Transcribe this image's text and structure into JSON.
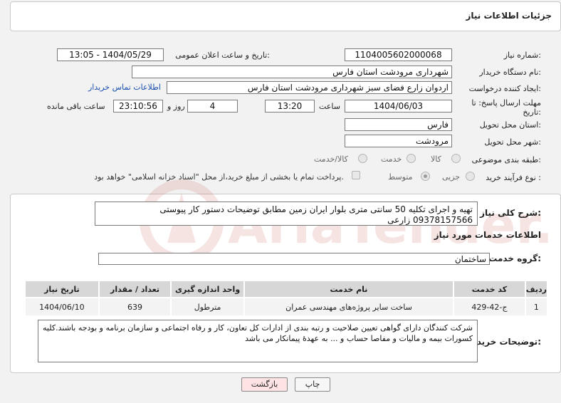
{
  "page_title": "جزئیات اطلاعات نیاز",
  "fields": {
    "need_number_label": "شماره نیاز:",
    "need_number": "1104005602000068",
    "announce_label": "تاریخ و ساعت اعلان عمومی:",
    "announce_value": "1404/05/29 - 13:05",
    "buyer_org_label": "نام دستگاه خریدار:",
    "buyer_org": "شهرداری مرودشت استان فارس",
    "creator_label": "ایجاد کننده درخواست:",
    "creator": "اردوان زارع فضای سبز شهرداری مرودشت استان فارس",
    "contact_link": "اطلاعات تماس خریدار",
    "deadline_label_line1": "مهلت ارسال پاسخ: تا",
    "deadline_label_line2": "تاریخ:",
    "deadline_date": "1404/06/03",
    "time_label": "ساعت",
    "deadline_time": "13:20",
    "days_value": "4",
    "days_label": "روز و",
    "remaining_time": "23:10:56",
    "remaining_label": "ساعت باقی مانده",
    "province_label": "استان محل تحویل:",
    "province": "فارس",
    "city_label": "شهر محل تحویل:",
    "city": "مرودشت",
    "category_label": "طبقه بندی موضوعی:",
    "category_options": [
      "کالا",
      "خدمت",
      "کالا/خدمت"
    ],
    "process_label": "نوع فرآیند خرید :",
    "process_options": [
      "جزیی",
      "متوسط"
    ],
    "payment_note": "پرداخت تمام یا بخشی از مبلغ خرید،از محل \"اسناد خزانه اسلامی\" خواهد بود."
  },
  "description": {
    "label": "شرح کلی نیاز:",
    "text": "تهیه و اجرای تکلیه 50 سانتی متری بلوار ایران زمین مطابق توضیحات دستور کار پیوستی 09378157566 زارعی"
  },
  "services": {
    "section_title": "اطلاعات خدمات مورد نیاز",
    "group_label": "گروه خدمت:",
    "group_value": "ساختمان",
    "columns": [
      "ردیف",
      "کد خدمت",
      "نام خدمت",
      "واحد اندازه گیری",
      "تعداد / مقدار",
      "تاریخ نیاز"
    ],
    "rows": [
      [
        "1",
        "ج-42-429",
        "ساخت سایر پروژه‌های مهندسی عمران",
        "مترطول",
        "639",
        "1404/06/10"
      ]
    ]
  },
  "buyer_notes": {
    "label": "توضیحات خریدار:",
    "text": "شرکت کنندگان  دارای گواهی تعیین صلاحیت و رتبه بندی از ادارات کل تعاون، کار و رفاه اجتماعی و سازمان برنامه و بودجه باشند.کلیه کسورات بیمه و مالیات و مفاصا حساب و ... به عهدهٔ پیمانکار می باشد"
  },
  "buttons": {
    "print": "چاپ",
    "back": "بازگشت"
  },
  "watermark": "AriaTender.neT",
  "colors": {
    "link": "#1a4fb0",
    "back_button_bg": "#fde3e3",
    "watermark": "#c0392b"
  }
}
